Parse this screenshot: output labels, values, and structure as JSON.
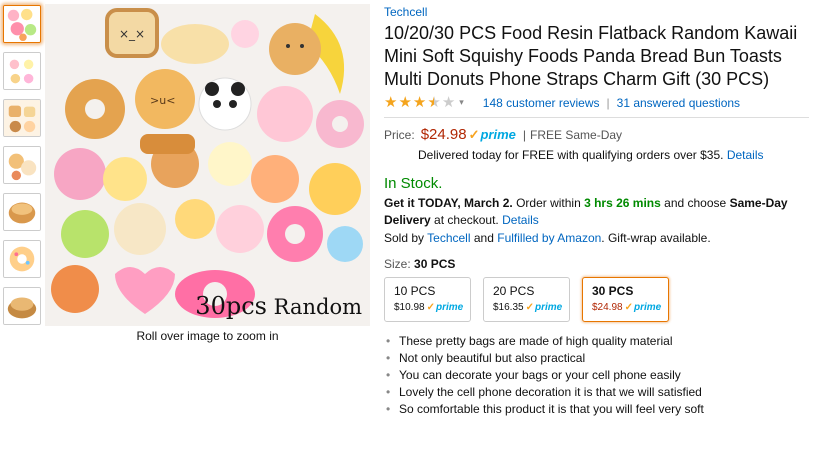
{
  "thumbnails": [
    {
      "alt": "thumb-1",
      "active": true
    },
    {
      "alt": "thumb-2",
      "active": false
    },
    {
      "alt": "thumb-3",
      "active": false
    },
    {
      "alt": "thumb-4",
      "active": false
    },
    {
      "alt": "thumb-5",
      "active": false
    },
    {
      "alt": "thumb-6",
      "active": false
    },
    {
      "alt": "thumb-7",
      "active": false
    }
  ],
  "main_image": {
    "caption_num": "30pcs",
    "caption_word": "Random"
  },
  "zoom_hint": "Roll over image to zoom in",
  "product": {
    "brand": "Techcell",
    "title": "10/20/30 PCS Food Resin Flatback Random Kawaii Mini Soft Squishy Foods Panda Bread Bun Toasts Multi Donuts Phone Straps Charm Gift (30 PCS)",
    "rating": 3.5,
    "rating_caret": "▾",
    "reviews_label": "148 customer reviews",
    "questions_label": "31 answered questions",
    "separator": "|"
  },
  "price": {
    "label": "Price:",
    "amount": "$24.98",
    "prime": "prime",
    "pipe": "|",
    "free_same_day": "FREE Same-Day",
    "delivery_note": "Delivered today for FREE with qualifying orders over $35.",
    "details_label": "Details"
  },
  "stock": {
    "status": "In Stock.",
    "get_it": "Get it TODAY, March 2.",
    "order_within": "Order within",
    "time_left": "3 hrs 26 mins",
    "and_choose": "and choose",
    "same_day": "Same-Day",
    "delivery": "Delivery",
    "at_checkout": "at checkout.",
    "details_label": "Details",
    "sold_by": "Sold by",
    "seller": "Techcell",
    "and": "and",
    "fulfilled": "Fulfilled by Amazon",
    "gift_wrap": ". Gift-wrap available."
  },
  "size": {
    "label": "Size:",
    "selected": "30 PCS",
    "options": [
      {
        "name": "10 PCS",
        "price": "$10.98",
        "prime": "prime",
        "selected": false
      },
      {
        "name": "20 PCS",
        "price": "$16.35",
        "prime": "prime",
        "selected": false
      },
      {
        "name": "30 PCS",
        "price": "$24.98",
        "prime": "prime",
        "selected": true
      }
    ]
  },
  "bullets": [
    "These pretty bags are made of high quality material",
    "Not only beautiful but also practical",
    "You can decorate your bags or your cell phone easily",
    "Lovely the cell phone decoration it is that we will satisfied",
    "So comfortable this product it is that you will feel very soft"
  ],
  "colors": {
    "link": "#0066c0",
    "price": "#b12704",
    "in_stock": "#008a00",
    "prime_blue": "#00a8e1",
    "star": "#f4a41d",
    "selected_border": "#e77600"
  }
}
